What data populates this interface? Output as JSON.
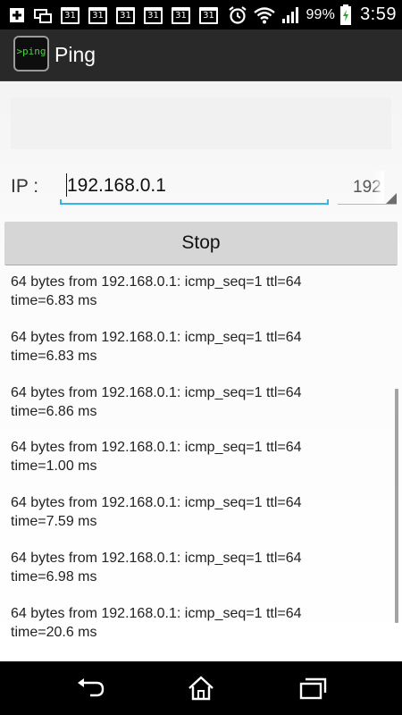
{
  "status_bar": {
    "notification_icons": [
      "add-box-icon",
      "screen-share-icon",
      "calendar-icon",
      "calendar-icon",
      "calendar-icon",
      "calendar-icon",
      "calendar-icon",
      "calendar-icon"
    ],
    "calendar_day": "31",
    "right_icons": [
      "alarm-icon",
      "wifi-icon",
      "signal-icon",
      "battery-icon"
    ],
    "battery_percent": "99%",
    "time": "3:59"
  },
  "app_bar": {
    "icon_text": ">ping",
    "title": "Ping"
  },
  "form": {
    "ip_label": "IP :",
    "ip_value": "192.168.0.1",
    "history_value": "192",
    "stop_label": "Stop"
  },
  "results": [
    {
      "line1": "64 bytes from 192.168.0.1: icmp_seq=1 ttl=64",
      "line2": "time=6.83 ms"
    },
    {
      "line1": "64 bytes from 192.168.0.1: icmp_seq=1 ttl=64",
      "line2": "time=6.83 ms"
    },
    {
      "line1": "64 bytes from 192.168.0.1: icmp_seq=1 ttl=64",
      "line2": "time=6.86 ms"
    },
    {
      "line1": "64 bytes from 192.168.0.1: icmp_seq=1 ttl=64",
      "line2": "time=1.00 ms"
    },
    {
      "line1": "64 bytes from 192.168.0.1: icmp_seq=1 ttl=64",
      "line2": "time=7.59 ms"
    },
    {
      "line1": "64 bytes from 192.168.0.1: icmp_seq=1 ttl=64",
      "line2": "time=6.98 ms"
    },
    {
      "line1": "64 bytes from 192.168.0.1: icmp_seq=1 ttl=64",
      "line2": "time=20.6 ms"
    }
  ],
  "nav_bar": {
    "buttons": [
      "back-icon",
      "home-icon",
      "recent-apps-icon"
    ]
  },
  "colors": {
    "accent": "#33b5e5",
    "app_icon_text": "#4cd148",
    "action_bar": "#292929",
    "button": "#d6d6d6"
  }
}
